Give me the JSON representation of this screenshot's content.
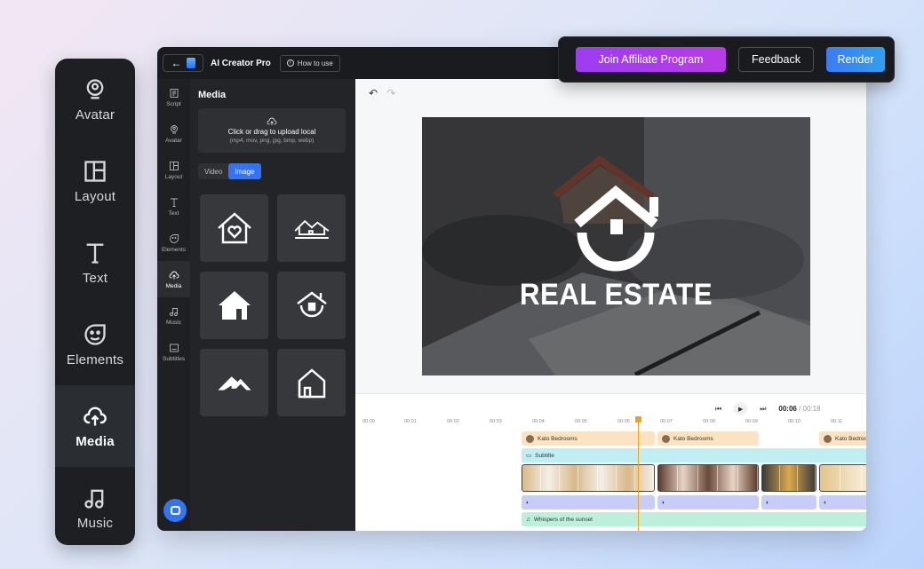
{
  "sidebar_large": {
    "items": [
      {
        "label": "Avatar",
        "icon": "avatar-icon",
        "active": false
      },
      {
        "label": "Layout",
        "icon": "layout-icon",
        "active": false
      },
      {
        "label": "Text",
        "icon": "text-icon",
        "active": false
      },
      {
        "label": "Elements",
        "icon": "elements-icon",
        "active": false
      },
      {
        "label": "Media",
        "icon": "media-upload-icon",
        "active": true
      },
      {
        "label": "Music",
        "icon": "music-icon",
        "active": false
      }
    ]
  },
  "topbar": {
    "back_arrow": "←",
    "app_title": "AI Creator Pro",
    "how_to_label": "How to use"
  },
  "actions": {
    "affiliate_label": "Join Affiliate Program",
    "feedback_label": "Feedback",
    "render_label": "Render"
  },
  "nav": {
    "items": [
      {
        "label": "Script",
        "icon": "script-icon"
      },
      {
        "label": "Avatar",
        "icon": "avatar-icon"
      },
      {
        "label": "Layout",
        "icon": "layout-icon"
      },
      {
        "label": "Text",
        "icon": "text-icon"
      },
      {
        "label": "Elements",
        "icon": "elements-icon"
      },
      {
        "label": "Media",
        "icon": "media-upload-icon",
        "active": true
      },
      {
        "label": "Music",
        "icon": "music-icon"
      },
      {
        "label": "Subtitles",
        "icon": "subtitles-icon"
      }
    ]
  },
  "panel": {
    "title": "Media",
    "upload_title": "Click or drag to upload local",
    "upload_formats": "(mp4, mov, png, jpg, bmp, webp)",
    "tab_video": "Video",
    "tab_image": "Image",
    "active_tab": "Image",
    "tiles": [
      "house-heart-icon",
      "house-roofline-icon",
      "house-solid-icon",
      "house-circle-icon",
      "roof-icon",
      "house-outline-icon"
    ]
  },
  "canvas": {
    "headline": "REAL ESTATE"
  },
  "timeline": {
    "current_time": "00:06",
    "separator": " / ",
    "total_time": "00:18",
    "ticks": [
      "00:00",
      "00:01",
      "00:02",
      "00:03",
      "00:04",
      "00:05",
      "00:06",
      "00:07",
      "00:08",
      "00:09",
      "00:10",
      "00:11"
    ],
    "avatar_track_label": "Kato Bedrooms",
    "subtitle_track_label": "Subtitle",
    "music_track_label": "Whispers of the sunset"
  },
  "colors": {
    "accent_blue": "#3574f0",
    "affiliate_purple": "#9c3df0",
    "playhead": "#f0a020"
  }
}
